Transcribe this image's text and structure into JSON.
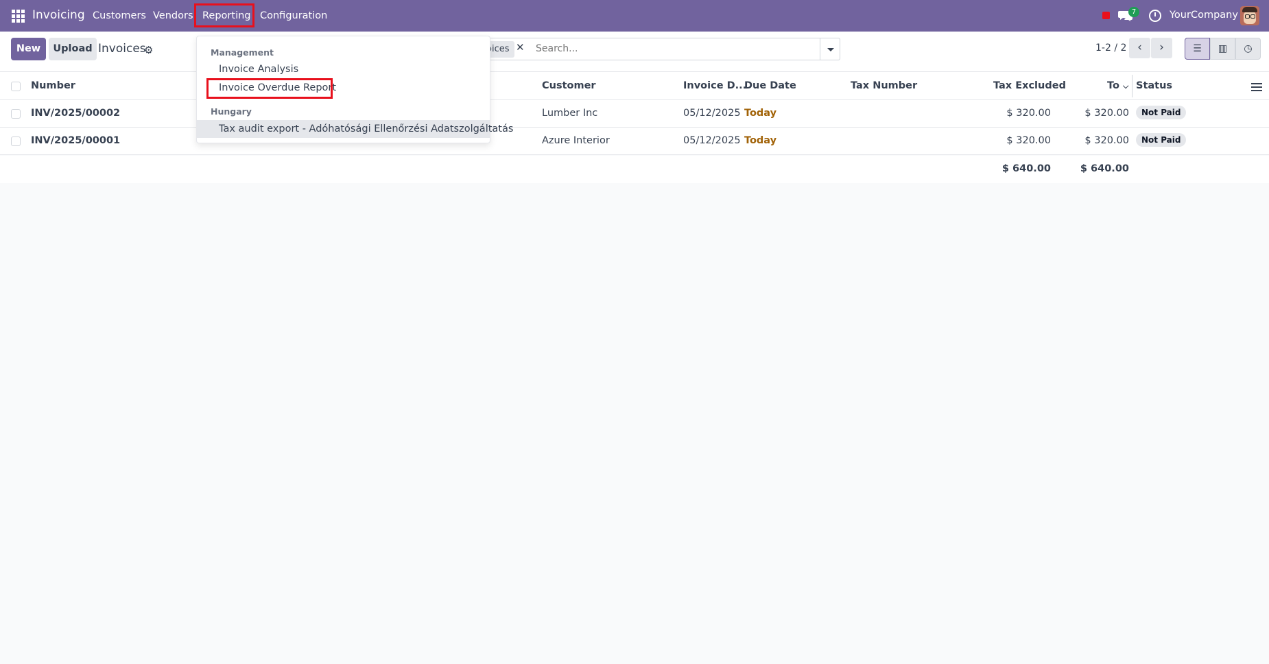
{
  "navbar": {
    "brand": "Invoicing",
    "menu": [
      "Customers",
      "Vendors",
      "Reporting",
      "Configuration"
    ],
    "chat_count": "7",
    "company": "YourCompany"
  },
  "control": {
    "new_label": "New",
    "upload_label": "Upload",
    "title": "Invoices",
    "facet_label": "oices",
    "search_placeholder": "Search...",
    "pager": "1-2 / 2"
  },
  "table": {
    "headers": {
      "number": "Number",
      "customer": "Customer",
      "invoice_date": "Invoice D...",
      "due_date": "Due Date",
      "tax_number": "Tax Number",
      "tax_excluded": "Tax Excluded",
      "total": "To",
      "status": "Status"
    },
    "rows": [
      {
        "number": "INV/2025/00002",
        "customer": "Lumber Inc",
        "invoice_date": "05/12/2025",
        "due_date": "Today",
        "tax_number": "",
        "tax_excluded": "$ 320.00",
        "total": "$ 320.00",
        "status": "Not Paid"
      },
      {
        "number": "INV/2025/00001",
        "customer": "Azure Interior",
        "invoice_date": "05/12/2025",
        "due_date": "Today",
        "tax_number": "",
        "tax_excluded": "$ 320.00",
        "total": "$ 320.00",
        "status": "Not Paid"
      }
    ],
    "totals": {
      "tax_excluded": "$ 640.00",
      "total": "$ 640.00"
    }
  },
  "dropdown": {
    "section1": "Management",
    "items1": [
      "Invoice Analysis",
      "Invoice Overdue Report"
    ],
    "section2": "Hungary",
    "items2": [
      "Tax audit export - Adóhatósági Ellenőrzési Adatszolgáltatás"
    ]
  },
  "colors": {
    "brand": "#71639e",
    "highlight": "#e8101c",
    "due_today": "#a16207"
  }
}
